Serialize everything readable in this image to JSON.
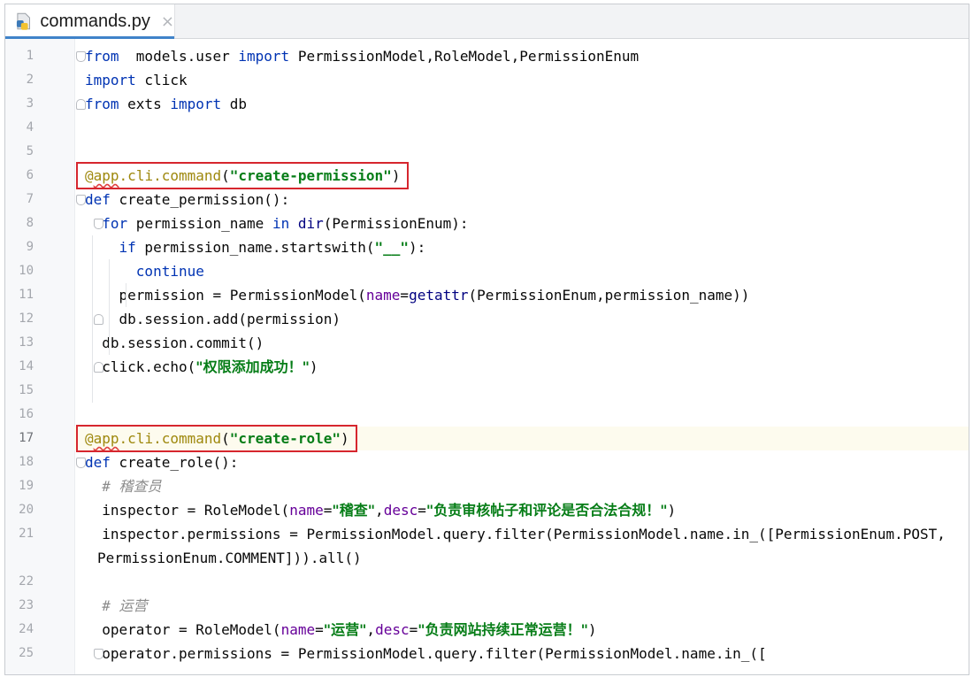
{
  "tab": {
    "filename": "commands.py",
    "close_glyph": "×",
    "icon": "python-file-icon"
  },
  "colors": {
    "keyword": "#0033b3",
    "string": "#067d17",
    "decorator": "#9e880d",
    "comment": "#8c8c8c",
    "highlight_box": "#d6262e"
  },
  "editor": {
    "current_line": 17,
    "lines": [
      {
        "n": "1",
        "segs": [
          [
            "kw",
            "from"
          ],
          [
            "",
            "  models.user "
          ],
          [
            "kw",
            "import"
          ],
          [
            "",
            " PermissionModel,RoleModel,PermissionEnum"
          ]
        ]
      },
      {
        "n": "2",
        "segs": [
          [
            "kw",
            "import"
          ],
          [
            "",
            " click"
          ]
        ]
      },
      {
        "n": "3",
        "segs": [
          [
            "kw",
            "from"
          ],
          [
            "",
            " exts "
          ],
          [
            "kw",
            "import"
          ],
          [
            "",
            " db"
          ]
        ]
      },
      {
        "n": "4",
        "segs": []
      },
      {
        "n": "5",
        "segs": []
      },
      {
        "n": "6",
        "segs": [
          [
            "dec",
            "@"
          ],
          [
            "dec squig",
            "app"
          ],
          [
            "dec",
            ".cli.command"
          ],
          [
            "",
            "("
          ],
          [
            "str",
            "\"create-permission\""
          ],
          [
            "",
            ")"
          ]
        ]
      },
      {
        "n": "7",
        "segs": [
          [
            "kw",
            "def"
          ],
          [
            "",
            " create_permission():"
          ]
        ]
      },
      {
        "n": "8",
        "segs": [
          [
            "",
            "  "
          ],
          [
            "kw",
            "for"
          ],
          [
            "",
            " permission_name "
          ],
          [
            "kw",
            "in"
          ],
          [
            "",
            " "
          ],
          [
            "builtin",
            "dir"
          ],
          [
            "",
            "(PermissionEnum):"
          ]
        ]
      },
      {
        "n": "9",
        "segs": [
          [
            "",
            "    "
          ],
          [
            "kw",
            "if"
          ],
          [
            "",
            " permission_name.startswith("
          ],
          [
            "str",
            "\"__\""
          ],
          [
            "",
            "):"
          ]
        ]
      },
      {
        "n": "10",
        "segs": [
          [
            "",
            "      "
          ],
          [
            "kw",
            "continue"
          ]
        ]
      },
      {
        "n": "11",
        "segs": [
          [
            "",
            "    permission = PermissionModel("
          ],
          [
            "param",
            "name"
          ],
          [
            "",
            "="
          ],
          [
            "builtin",
            "getattr"
          ],
          [
            "",
            "(PermissionEnum,permission_name))"
          ]
        ]
      },
      {
        "n": "12",
        "segs": [
          [
            "",
            "    db.session.add(permission)"
          ]
        ]
      },
      {
        "n": "13",
        "segs": [
          [
            "",
            "  db.session.commit()"
          ]
        ]
      },
      {
        "n": "14",
        "segs": [
          [
            "",
            "  click.echo("
          ],
          [
            "str cjk",
            "\"权限添加成功！\""
          ],
          [
            "",
            ")"
          ]
        ]
      },
      {
        "n": "15",
        "segs": []
      },
      {
        "n": "16",
        "segs": []
      },
      {
        "n": "17",
        "segs": [
          [
            "dec",
            "@"
          ],
          [
            "dec squig",
            "app"
          ],
          [
            "dec",
            ".cli.command"
          ],
          [
            "",
            "("
          ],
          [
            "str",
            "\"create-role\""
          ],
          [
            "",
            ")"
          ]
        ]
      },
      {
        "n": "18",
        "segs": [
          [
            "kw",
            "def"
          ],
          [
            "",
            " create_role():"
          ]
        ]
      },
      {
        "n": "19",
        "segs": [
          [
            "",
            "  "
          ],
          [
            "cmt",
            "# "
          ],
          [
            "cmt cjk",
            "稽查员"
          ]
        ]
      },
      {
        "n": "20",
        "segs": [
          [
            "",
            "  inspector = RoleModel("
          ],
          [
            "param",
            "name"
          ],
          [
            "",
            "="
          ],
          [
            "str cjk",
            "\"稽查\""
          ],
          [
            "",
            ","
          ],
          [
            "param",
            "desc"
          ],
          [
            "",
            "="
          ],
          [
            "str cjk",
            "\"负责审核帖子和评论是否合法合规！\""
          ],
          [
            "",
            ")"
          ]
        ]
      },
      {
        "n": "21",
        "segs": [
          [
            "",
            "  inspector.permissions = PermissionModel.query.filter(PermissionModel.name.in_([PermissionEnum.POST,"
          ]
        ]
      },
      {
        "n": "",
        "segs": [
          [
            "",
            "PermissionEnum.COMMENT])).all()"
          ]
        ]
      },
      {
        "n": "22",
        "segs": []
      },
      {
        "n": "23",
        "segs": [
          [
            "",
            "  "
          ],
          [
            "cmt",
            "# "
          ],
          [
            "cmt cjk",
            "运营"
          ]
        ]
      },
      {
        "n": "24",
        "segs": [
          [
            "",
            "  operator = RoleModel("
          ],
          [
            "param",
            "name"
          ],
          [
            "",
            "="
          ],
          [
            "str cjk",
            "\"运营\""
          ],
          [
            "",
            ","
          ],
          [
            "param",
            "desc"
          ],
          [
            "",
            "="
          ],
          [
            "str cjk",
            "\"负责网站持续正常运营！\""
          ],
          [
            "",
            ")"
          ]
        ]
      },
      {
        "n": "25",
        "segs": [
          [
            "",
            "  operator.permissions = PermissionModel.query.filter(PermissionModel.name.in_(["
          ]
        ]
      }
    ]
  }
}
